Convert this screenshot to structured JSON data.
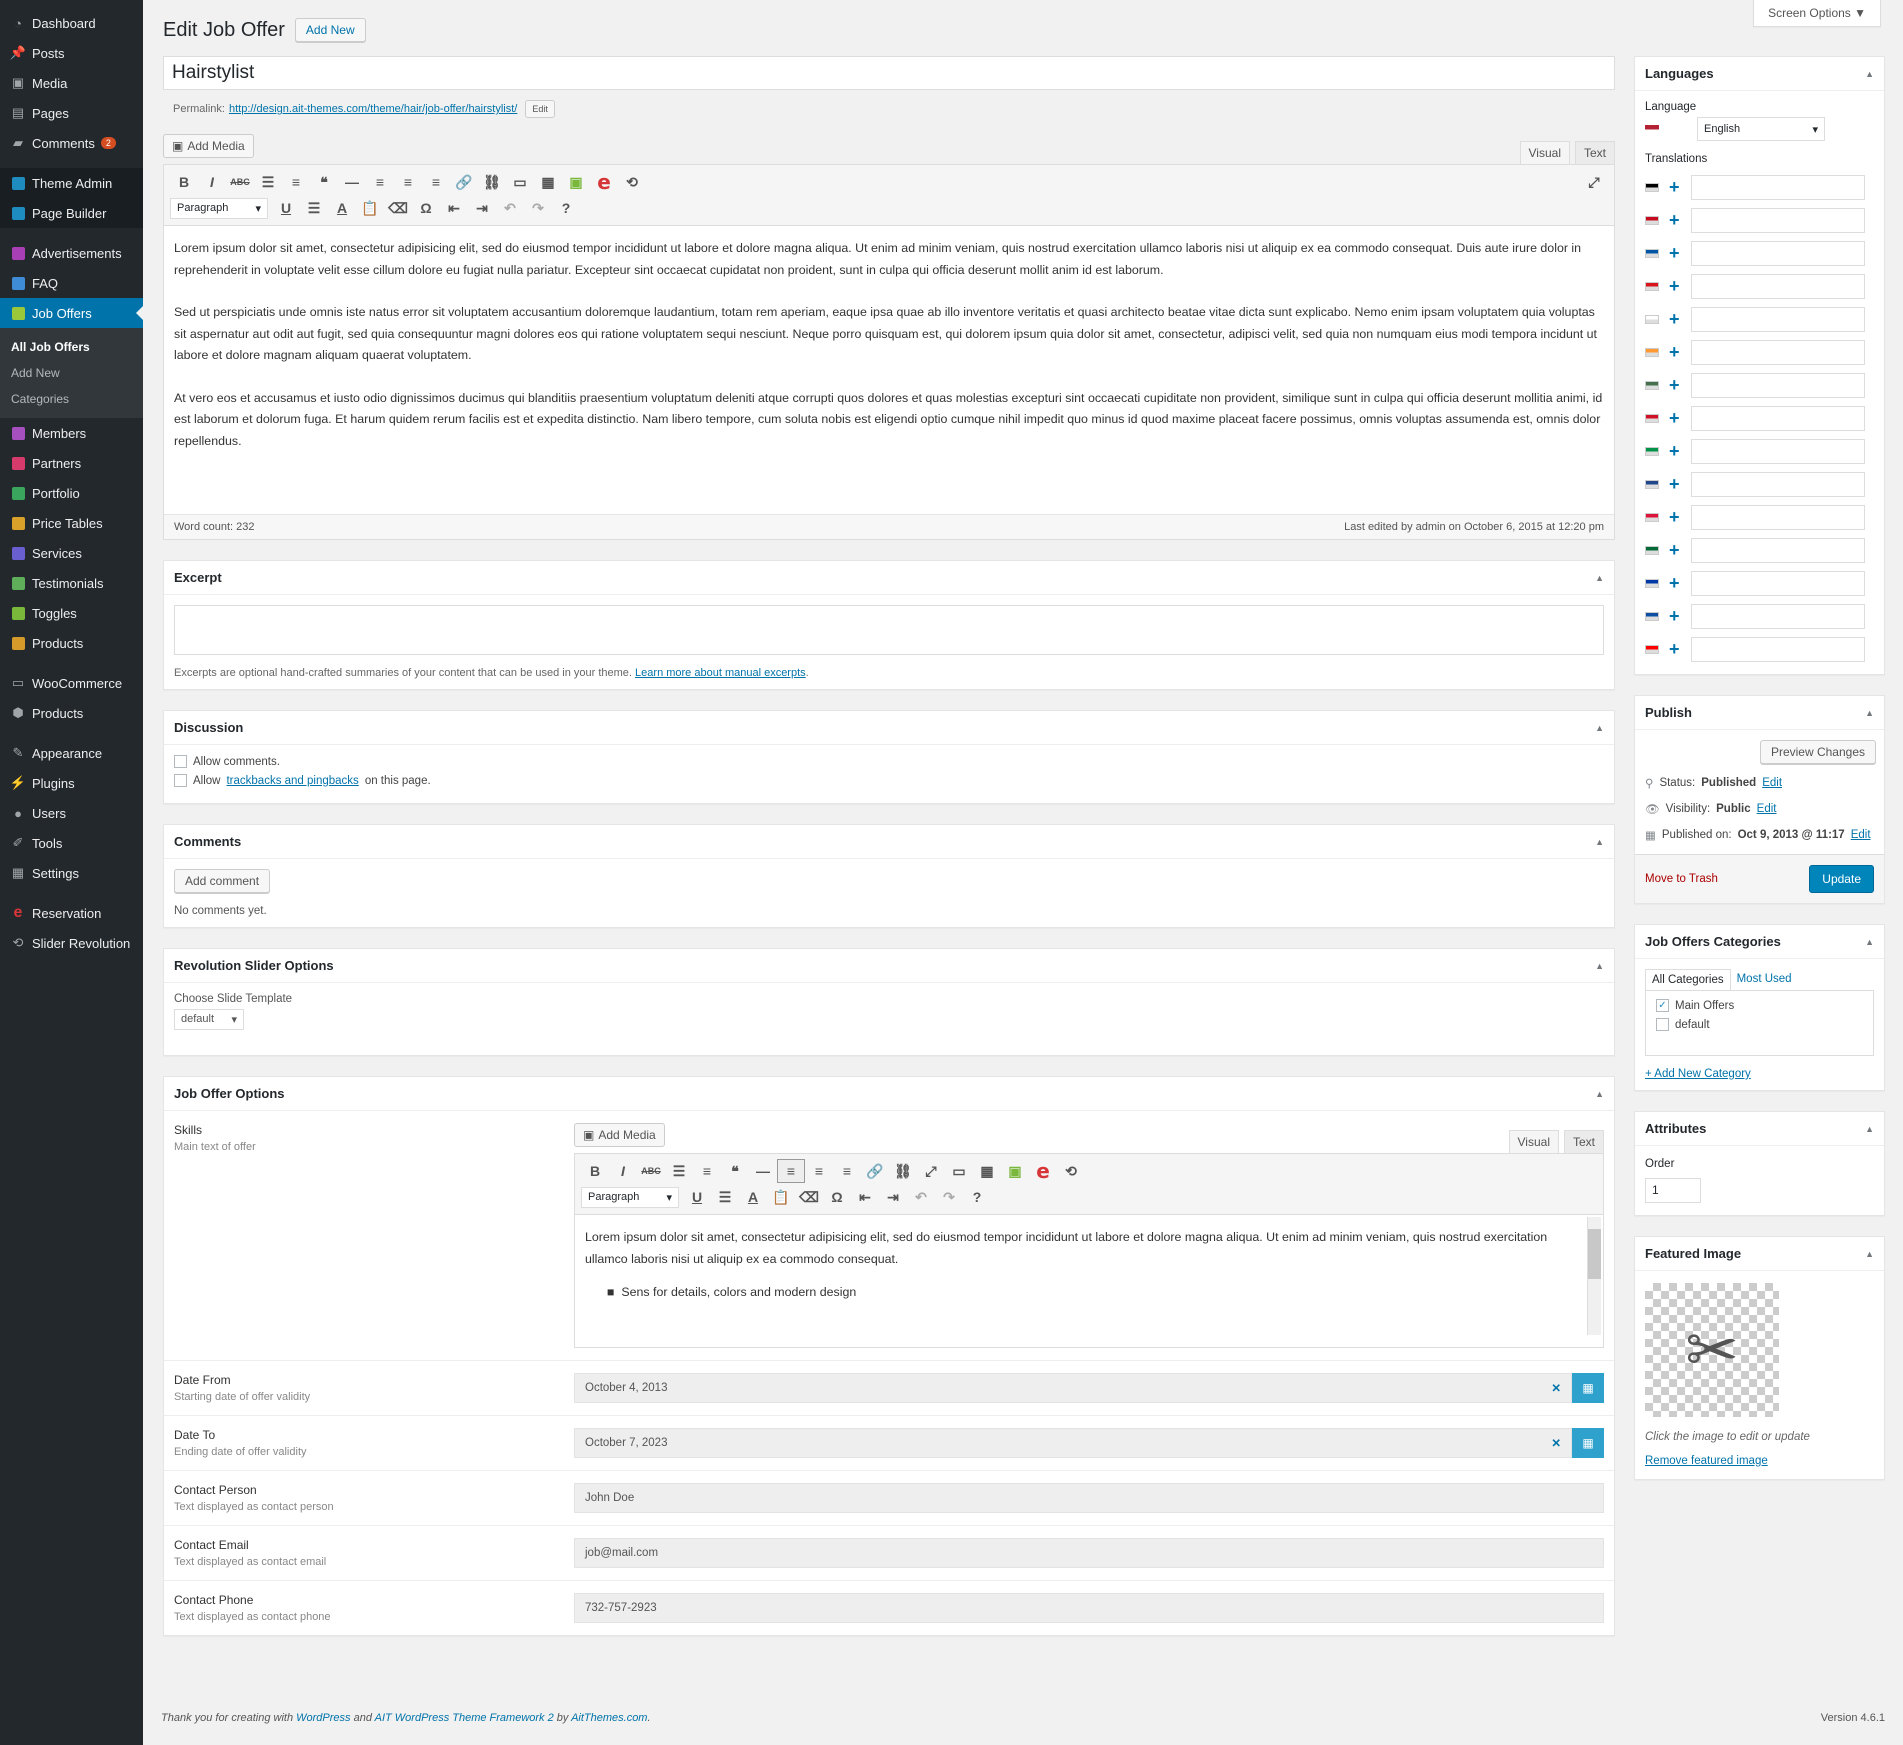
{
  "sidebar": {
    "items": [
      {
        "label": "Dashboard",
        "icon": "dashboard-icon",
        "glyph": "◔"
      },
      {
        "label": "Posts",
        "icon": "pin-icon",
        "glyph": "📌"
      },
      {
        "label": "Media",
        "icon": "media-icon",
        "glyph": "▣"
      },
      {
        "label": "Pages",
        "icon": "pages-icon",
        "glyph": "▤"
      },
      {
        "label": "Comments",
        "icon": "comment-icon",
        "glyph": "▰",
        "badge": "2"
      },
      {
        "label": "Theme Admin",
        "icon": "theme-admin-icon",
        "color": "#1e8cbe"
      },
      {
        "label": "Page Builder",
        "icon": "page-builder-icon",
        "color": "#1e8cbe"
      },
      {
        "label": "Advertisements",
        "icon": "ads-icon",
        "color": "#a83fb5"
      },
      {
        "label": "FAQ",
        "icon": "faq-icon",
        "color": "#3f8cd6"
      },
      {
        "label": "Job Offers",
        "icon": "job-offers-icon",
        "color": "#9ac83a"
      },
      {
        "label": "Members",
        "icon": "members-icon",
        "color": "#a64fbf"
      },
      {
        "label": "Partners",
        "icon": "partners-icon",
        "color": "#d63b6b"
      },
      {
        "label": "Portfolio",
        "icon": "portfolio-icon",
        "color": "#3aa55c"
      },
      {
        "label": "Price Tables",
        "icon": "price-tables-icon",
        "color": "#d9a12a"
      },
      {
        "label": "Services",
        "icon": "services-icon",
        "color": "#6a5fd1"
      },
      {
        "label": "Testimonials",
        "icon": "testimonials-icon",
        "color": "#5fae5a"
      },
      {
        "label": "Toggles",
        "icon": "toggles-icon",
        "color": "#7ab83c"
      },
      {
        "label": "Products",
        "icon": "products-icon",
        "color": "#d69a2a"
      },
      {
        "label": "WooCommerce",
        "icon": "woocommerce-icon",
        "glyph": "▭"
      },
      {
        "label": "Products",
        "icon": "box-icon",
        "glyph": "⬢"
      },
      {
        "label": "Appearance",
        "icon": "paintbrush-icon",
        "glyph": "✎"
      },
      {
        "label": "Plugins",
        "icon": "plugin-icon",
        "glyph": "⚡"
      },
      {
        "label": "Users",
        "icon": "users-icon",
        "glyph": "●"
      },
      {
        "label": "Tools",
        "icon": "wrench-icon",
        "glyph": "✐"
      },
      {
        "label": "Settings",
        "icon": "settings-icon",
        "glyph": "▦"
      },
      {
        "label": "Reservation",
        "icon": "reservation-icon",
        "glyph": "e"
      },
      {
        "label": "Slider Revolution",
        "icon": "slider-revolution-icon",
        "glyph": "⟲"
      }
    ],
    "submenu": [
      "All Job Offers",
      "Add New",
      "Categories"
    ]
  },
  "header": {
    "title": "Edit Job Offer",
    "add_new": "Add New",
    "screen_options": "Screen Options ▼"
  },
  "post": {
    "title": "Hairstylist",
    "permalink_label": "Permalink:",
    "permalink_url": "http://design.ait-themes.com/theme/hair/job-offer/hairstylist/",
    "permalink_edit": "Edit"
  },
  "editor": {
    "add_media": "Add Media",
    "tab_visual": "Visual",
    "tab_text": "Text",
    "format": "Paragraph",
    "paragraphs": [
      "Lorem ipsum dolor sit amet, consectetur adipisicing elit, sed do eiusmod tempor incididunt ut labore et dolore magna aliqua. Ut enim ad minim veniam, quis nostrud exercitation ullamco laboris nisi ut aliquip ex ea commodo consequat. Duis aute irure dolor in reprehenderit in voluptate velit esse cillum dolore eu fugiat nulla pariatur. Excepteur sint occaecat cupidatat non proident, sunt in culpa qui officia deserunt mollit anim id est laborum.",
      "Sed ut perspiciatis unde omnis iste natus error sit voluptatem accusantium doloremque laudantium, totam rem aperiam, eaque ipsa quae ab illo inventore veritatis et quasi architecto beatae vitae dicta sunt explicabo. Nemo enim ipsam voluptatem quia voluptas sit aspernatur aut odit aut fugit, sed quia consequuntur magni dolores eos qui ratione voluptatem sequi nesciunt. Neque porro quisquam est, qui dolorem ipsum quia dolor sit amet, consectetur, adipisci velit, sed quia non numquam eius modi tempora incidunt ut labore et dolore magnam aliquam quaerat voluptatem.",
      "At vero eos et accusamus et iusto odio dignissimos ducimus qui blanditiis praesentium voluptatum deleniti atque corrupti quos dolores et quas molestias excepturi sint occaecati cupiditate non provident, similique sunt in culpa qui officia deserunt mollitia animi, id est laborum et dolorum fuga. Et harum quidem rerum facilis est et expedita distinctio. Nam libero tempore, cum soluta nobis est eligendi optio cumque nihil impedit quo minus id quod maxime placeat facere pos­simus, omnis voluptas assumenda est, omnis dolor repellendus."
    ],
    "word_count": "Word count: 232",
    "last_edited": "Last edited by admin on October 6, 2015 at 12:20 pm"
  },
  "excerpt": {
    "title": "Excerpt",
    "hint": "Excerpts are optional hand-crafted summaries of your content that can be used in your theme.",
    "link": "Learn more about manual excerpts"
  },
  "discussion": {
    "title": "Discussion",
    "allow_comments": "Allow comments.",
    "allow_prefix": "Allow",
    "trackbacks_link": "trackbacks and pingbacks",
    "allow_suffix": "on this page."
  },
  "comments": {
    "title": "Comments",
    "add_comment": "Add comment",
    "none": "No comments yet."
  },
  "revslider": {
    "title": "Revolution Slider Options",
    "label": "Choose Slide Template",
    "value": "default"
  },
  "job_options": {
    "title": "Job Offer Options",
    "skills_label": "Skills",
    "skills_desc": "Main text of offer",
    "skills_text": "Lorem ipsum dolor sit amet, consectetur adipisicing elit, sed do eiusmod tempor incididunt ut labore et dolore magna aliqua. Ut enim ad minim veniam, quis nostrud exercitation ullamco laboris nisi ut aliquip ex ea commodo consequat.",
    "skills_bullet": "Sens for details, colors and modern design",
    "date_from_label": "Date From",
    "date_from_desc": "Starting date of offer validity",
    "date_from": "October 4, 2013",
    "date_to_label": "Date To",
    "date_to_desc": "Ending date of offer validity",
    "date_to": "October 7, 2023",
    "person_label": "Contact Person",
    "person_desc": "Text displayed as contact person",
    "person": "John Doe",
    "email_label": "Contact Email",
    "email_desc": "Text displayed as contact email",
    "email": "job@mail.com",
    "phone_label": "Contact Phone",
    "phone_desc": "Text displayed as contact phone",
    "phone": "732-757-2923"
  },
  "languages": {
    "title": "Languages",
    "language_label": "Language",
    "language": "English",
    "translations_label": "Translations",
    "flags": [
      "#000000",
      "#c60b1e",
      "#0055a4",
      "#d7141a",
      "#ffffff",
      "#ff9933",
      "#436f4d",
      "#ce1126",
      "#009246",
      "#21468b",
      "#dc143c",
      "#046a38",
      "#0039a6",
      "#0b4ea2",
      "#fe0000"
    ]
  },
  "publish": {
    "title": "Publish",
    "preview": "Preview Changes",
    "status_label": "Status:",
    "status": "Published",
    "visibility_label": "Visibility:",
    "visibility": "Public",
    "published_label": "Published on:",
    "published": "Oct 9, 2013 @ 11:17",
    "edit": "Edit",
    "trash": "Move to Trash",
    "update": "Update"
  },
  "categories": {
    "title": "Job Offers Categories",
    "tab_all": "All Categories",
    "tab_most": "Most Used",
    "items": [
      "Main Offers",
      "default"
    ],
    "add_new": "+ Add New Category"
  },
  "attributes": {
    "title": "Attributes",
    "order_label": "Order",
    "order": "1"
  },
  "featured": {
    "title": "Featured Image",
    "hint": "Click the image to edit or update",
    "remove": "Remove featured image"
  },
  "footer": {
    "thanks": "Thank you for creating with",
    "wp": "WordPress",
    "and": "and",
    "ait": "AIT WordPress Theme Framework 2",
    "by": "by",
    "aitthemes": "AitThemes.com",
    "version": "Version 4.6.1"
  }
}
